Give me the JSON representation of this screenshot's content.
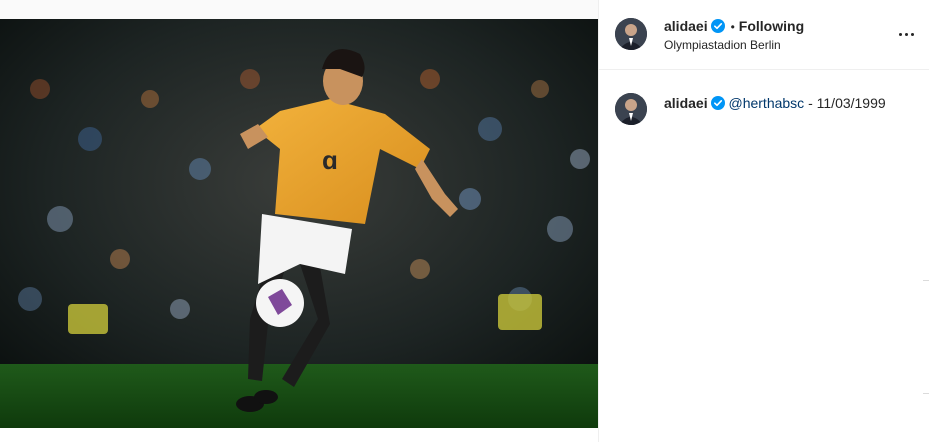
{
  "post": {
    "username": "alidaei",
    "follow_separator": "•",
    "follow_status": "Following",
    "location": "Olympiastadion Berlin",
    "more_label": "More options"
  },
  "caption": {
    "username": "alidaei",
    "mention": "@herthabsc",
    "separator": "-",
    "date": "11/03/1999"
  },
  "photo": {
    "alt": "Footballer in orange kit dribbling a ball on the pitch in front of a crowd"
  },
  "colors": {
    "verified_blue": "#0095f6",
    "mention_blue": "#00376b",
    "text": "#262626",
    "border": "#efefef"
  }
}
